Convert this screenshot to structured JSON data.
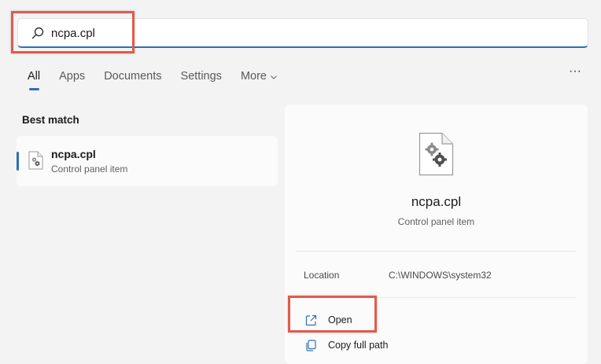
{
  "search": {
    "value": "ncpa.cpl",
    "icon": "search-icon"
  },
  "tabs": [
    {
      "label": "All",
      "active": true
    },
    {
      "label": "Apps",
      "active": false
    },
    {
      "label": "Documents",
      "active": false
    },
    {
      "label": "Settings",
      "active": false
    },
    {
      "label": "More",
      "active": false,
      "icon": "chevron-down-icon"
    }
  ],
  "options_label": "···",
  "best_match": {
    "heading": "Best match",
    "item": {
      "name": "ncpa.cpl",
      "type": "Control panel item",
      "icon": "control-panel-file-icon"
    }
  },
  "details": {
    "title": "ncpa.cpl",
    "subtitle": "Control panel item",
    "location_label": "Location",
    "location_value": "C:\\WINDOWS\\system32",
    "actions": [
      {
        "label": "Open",
        "icon": "open-external-icon"
      },
      {
        "label": "Copy full path",
        "icon": "copy-icon"
      }
    ]
  },
  "colors": {
    "accent": "#2f6fb7",
    "highlight": "#e35a4b",
    "background": "#f3f3f3",
    "panel": "#fbfbfb"
  }
}
